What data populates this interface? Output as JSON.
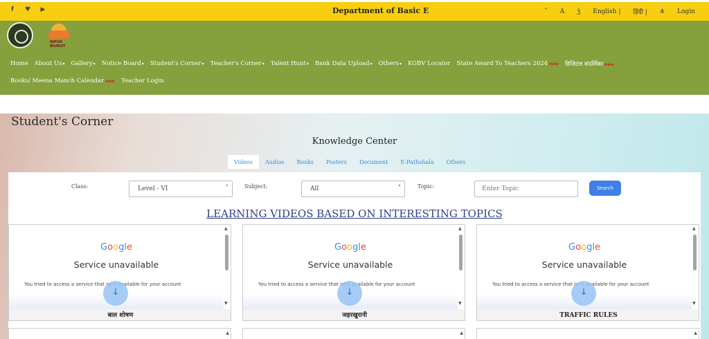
{
  "topbar": {
    "social": [
      {
        "name": "facebook-icon",
        "glyph": "f"
      },
      {
        "name": "twitter-icon",
        "glyph": "♥"
      },
      {
        "name": "youtube-icon",
        "glyph": "▶"
      }
    ],
    "title": "Department of Basic E",
    "tools": {
      "dropdown": "˅",
      "font_size": "A",
      "theme": "ǯ",
      "english": "English |",
      "hindi": "हिंदी |",
      "sitemap": "⋔",
      "login": "Login"
    }
  },
  "header": {
    "logo_text": "NIPUN BHARAT",
    "nav": [
      {
        "label": "Home",
        "caret": ""
      },
      {
        "label": "About Us",
        "caret": "▾"
      },
      {
        "label": "Gallery",
        "caret": "▾"
      },
      {
        "label": "Notice Board",
        "caret": "▾"
      },
      {
        "label": "Student's Corner",
        "caret": "▾"
      },
      {
        "label": "Teacher's Corner",
        "caret": "▾"
      },
      {
        "label": "Talent Hunt",
        "caret": "▾"
      },
      {
        "label": "Bank Data Upload",
        "caret": "▾"
      },
      {
        "label": "Others",
        "caret": "▾"
      },
      {
        "label": "KGBV Locator",
        "caret": ""
      },
      {
        "label": "State Award To Teachers 2024",
        "caret": "",
        "badge": "new"
      },
      {
        "label": "डिजिटल संदर्शिका",
        "caret": "",
        "badge": "new"
      },
      {
        "label": "Books/ Meena Manch Calendar",
        "caret": "",
        "badge": "new"
      },
      {
        "label": "Teacher Login",
        "caret": ""
      }
    ]
  },
  "main": {
    "page_title": "Student's Corner",
    "section_title": "Knowledge Center",
    "tabs": [
      "Videos",
      "Audios",
      "Books",
      "Posters",
      "Document",
      "E-Pathshala",
      "Others"
    ],
    "filters": {
      "class_label": "Class:",
      "class_value": "Level - VI",
      "subject_label": "Subject:",
      "subject_value": "All",
      "topic_label": "Topic:",
      "topic_placeholder": "Enter Topic",
      "search_label": "Search"
    },
    "heading": "LEARNING VIDEOS BASED ON INTERESTING TOPICS",
    "cards": [
      {
        "google": "Google",
        "status": "Service unavailable",
        "message": "You tried to access a service that isn't available for your account",
        "caption": "बाल शोषण"
      },
      {
        "google": "Google",
        "status": "Service unavailable",
        "message": "You tried to access a service that isn't available for your account",
        "caption": "जहरखुरानी"
      },
      {
        "google": "Google",
        "status": "Service unavailable",
        "message": "You tried to access a service that isn't available for your account",
        "caption": "TRAFFIC RULES"
      }
    ],
    "download_icon": "↓",
    "scroll_up": "▲",
    "scroll_down": "▼"
  },
  "colors": {
    "topbar": "#f7cf10",
    "header": "#85a03d",
    "tab_link": "#3d8bd6",
    "search_button": "#3f7fe6",
    "heading": "#2e3e8a"
  }
}
